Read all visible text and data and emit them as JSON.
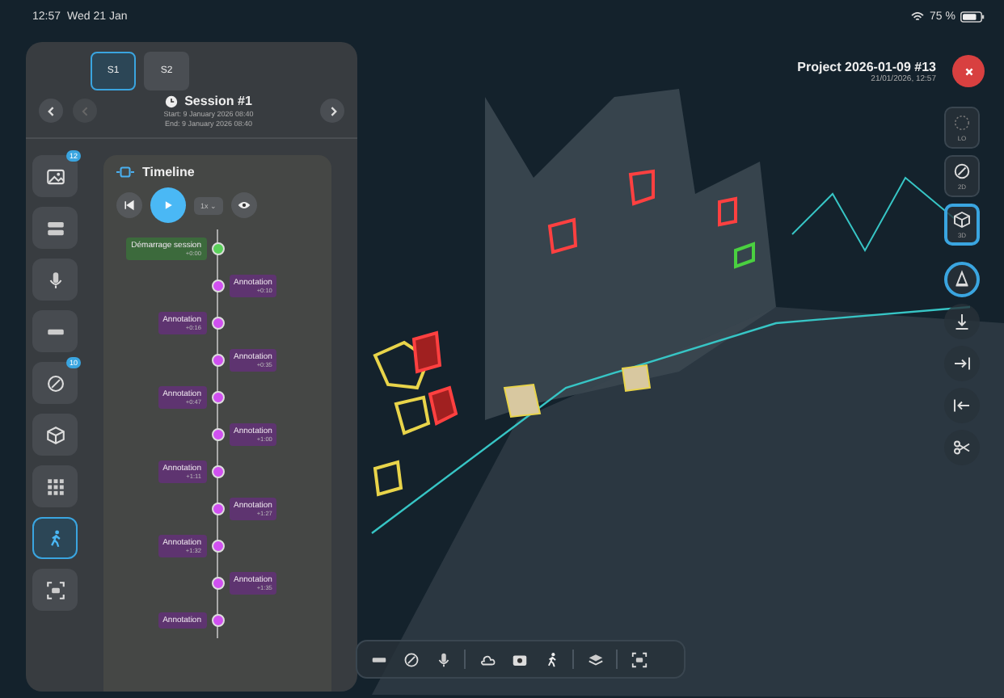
{
  "status_bar": {
    "time": "12:57",
    "date": "Wed 21 Jan",
    "battery": "75 %"
  },
  "project": {
    "title": "Project 2026-01-09 #13",
    "subtitle": "21/01/2026, 12:57"
  },
  "session_tabs": [
    {
      "label": "S1",
      "selected": true
    },
    {
      "label": "S2",
      "selected": false
    }
  ],
  "session": {
    "title": "Session #1",
    "start": "Start: 9 January 2026 08:40",
    "end": "End: 9 January 2026 08:40"
  },
  "sidebar": [
    {
      "badge": "12",
      "selected": false
    },
    {
      "selected": false
    },
    {
      "selected": false
    },
    {
      "selected": false
    },
    {
      "badge": "10",
      "selected": false
    },
    {
      "selected": false
    },
    {
      "selected": false
    },
    {
      "selected": true
    },
    {
      "selected": false
    }
  ],
  "timeline": {
    "title": "Timeline",
    "speed": "1x ⌄",
    "events": [
      {
        "kind": "start",
        "label": "Démarrage session",
        "time": "+0:00"
      },
      {
        "kind": "annotation",
        "label": "Annotation",
        "time": "+0:10"
      },
      {
        "kind": "annotation",
        "label": "Annotation",
        "time": "+0:16"
      },
      {
        "kind": "annotation",
        "label": "Annotation",
        "time": "+0:35"
      },
      {
        "kind": "annotation",
        "label": "Annotation",
        "time": "+0:47"
      },
      {
        "kind": "annotation",
        "label": "Annotation",
        "time": "+1:00"
      },
      {
        "kind": "annotation",
        "label": "Annotation",
        "time": "+1:11"
      },
      {
        "kind": "annotation",
        "label": "Annotation",
        "time": "+1:27"
      },
      {
        "kind": "annotation",
        "label": "Annotation",
        "time": "+1:32"
      },
      {
        "kind": "annotation",
        "label": "Annotation",
        "time": "+1:35"
      },
      {
        "kind": "annotation",
        "label": "Annotation"
      }
    ]
  },
  "view_modes": [
    {
      "label": "LO",
      "selected": false
    },
    {
      "label": "2D",
      "selected": false
    },
    {
      "label": "3D",
      "selected": true
    }
  ],
  "tools": [
    {
      "selected": true
    },
    {
      "selected": false
    },
    {
      "selected": false
    },
    {
      "selected": false
    },
    {
      "selected": false
    }
  ]
}
